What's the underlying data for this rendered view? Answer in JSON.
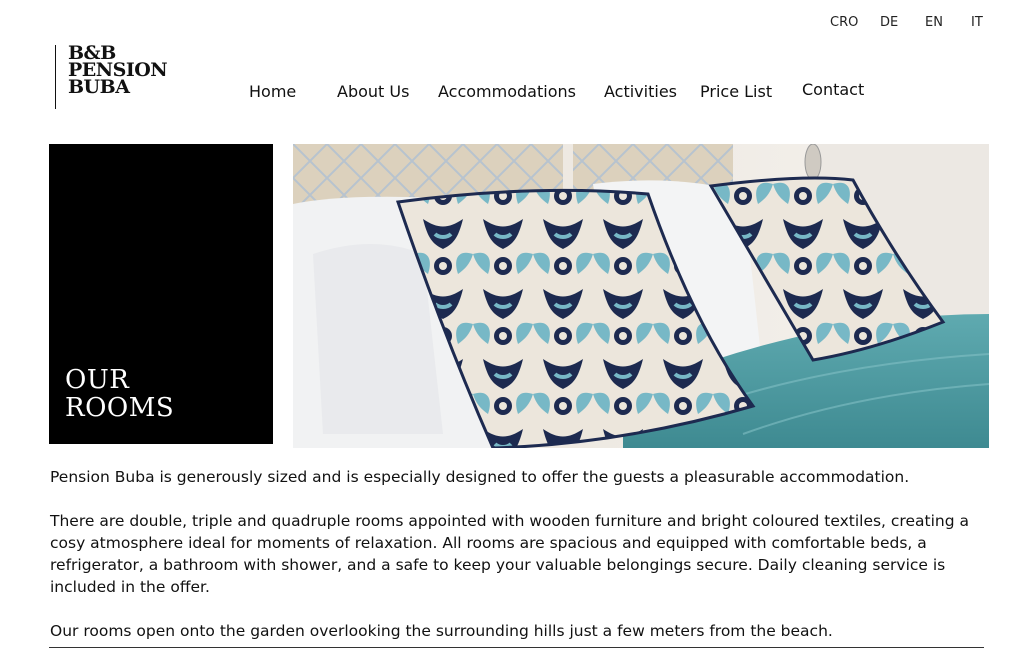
{
  "languages": [
    "CRO",
    "DE",
    "EN",
    "IT"
  ],
  "logo": {
    "line1": "B&B",
    "line2": "PENSION",
    "line3": "BUBA"
  },
  "nav": {
    "home": "Home",
    "about": "About Us",
    "accommodations": "Accommodations",
    "activities": "Activities",
    "price_list": "Price List",
    "contact": "Contact"
  },
  "hero_title": {
    "line1": "OUR",
    "line2": "ROOMS"
  },
  "paragraphs": [
    "Pension Buba is generously sized and is especially designed to offer the guests a pleasurable accommodation.",
    "There are double, triple and quadruple rooms appointed with wooden furniture and bright coloured textiles, creating a cosy atmosphere ideal for moments of relaxation. All rooms are spacious and equipped with comfortable beds, a refrigerator, a bathroom with shower, and a safe to keep your valuable belongings secure.  Daily cleaning service is included in the offer.",
    "Our rooms open onto the garden overlooking the surrounding hills just a few meters from the beach."
  ],
  "colors": {
    "title_box": "#000000",
    "pillow_navy": "#1d2a50",
    "pillow_aqua": "#6fb4c4",
    "blanket_teal": "#5aa2a6",
    "pillow_white": "#eef0f2",
    "headboard_beige": "#d8cdb8"
  }
}
